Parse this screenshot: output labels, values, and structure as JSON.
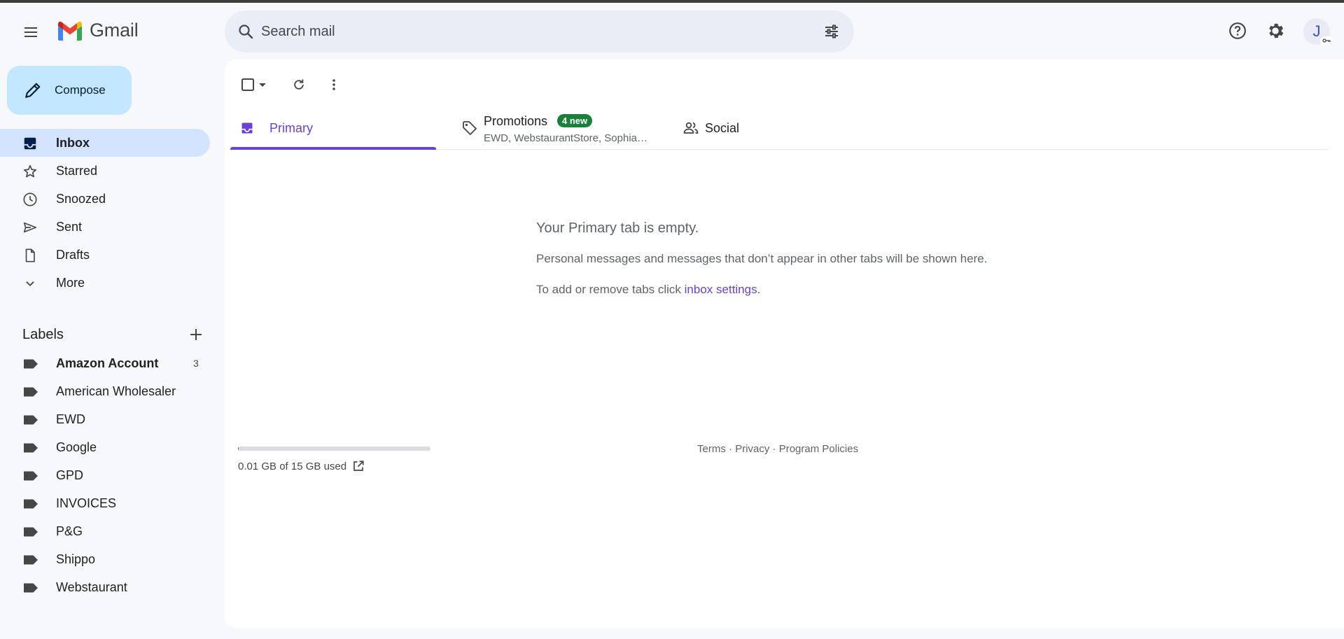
{
  "header": {
    "app_name": "Gmail",
    "search_placeholder": "Search mail",
    "avatar_initial": "J",
    "icons": [
      "menu-icon",
      "gmail-logo",
      "search-icon",
      "filter-options-icon",
      "help-icon",
      "settings-gear-icon",
      "account-avatar"
    ]
  },
  "sidebar": {
    "compose_label": "Compose",
    "nav": [
      {
        "label": "Inbox",
        "icon": "inbox-icon",
        "active": true
      },
      {
        "label": "Starred",
        "icon": "star-icon"
      },
      {
        "label": "Snoozed",
        "icon": "clock-icon"
      },
      {
        "label": "Sent",
        "icon": "send-icon"
      },
      {
        "label": "Drafts",
        "icon": "draft-file-icon"
      },
      {
        "label": "More",
        "icon": "chevron-down-icon"
      }
    ],
    "labels_title": "Labels",
    "labels": [
      {
        "label": "Amazon Account",
        "count": "3",
        "bold": true
      },
      {
        "label": "American Wholesaler"
      },
      {
        "label": "EWD"
      },
      {
        "label": "Google"
      },
      {
        "label": "GPD"
      },
      {
        "label": "INVOICES"
      },
      {
        "label": "P&G"
      },
      {
        "label": "Shippo"
      },
      {
        "label": "Webstaurant"
      }
    ]
  },
  "tabs": {
    "primary": {
      "label": "Primary"
    },
    "promotions": {
      "label": "Promotions",
      "badge": "4 new",
      "senders": "EWD, WebstaurantStore, Sophia…"
    },
    "social": {
      "label": "Social"
    }
  },
  "empty_state": {
    "title": "Your Primary tab is empty.",
    "description": "Personal messages and messages that don’t appear in other tabs will be shown here.",
    "tip_prefix": "To add or remove tabs click ",
    "tip_link": "inbox settings",
    "tip_suffix": "."
  },
  "footer": {
    "storage_text": "0.01 GB of 15 GB used",
    "storage_used_fraction": 0.001,
    "terms": "Terms",
    "privacy": "Privacy",
    "policies": "Program Policies",
    "separator": " · "
  },
  "colors": {
    "accent": "#6741d9",
    "compose_bg": "#c2e7ff",
    "active_nav_bg": "#d3e3fd",
    "badge_green": "#188038",
    "background": "#f6f8fc"
  }
}
